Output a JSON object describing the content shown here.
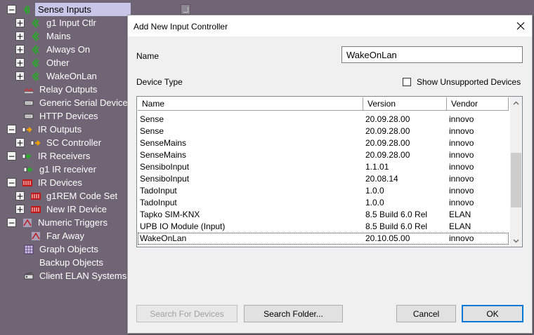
{
  "tree": {
    "nodes": [
      {
        "label": "Sense Inputs",
        "expander": "−",
        "icon": "sense-inputs-icon",
        "selected": true
      },
      {
        "label": "g1 Input Ctlr",
        "expander": "+",
        "icon": "sense-controller-icon"
      },
      {
        "label": "Mains",
        "expander": "+",
        "icon": "sense-controller-icon"
      },
      {
        "label": "Always On",
        "expander": "+",
        "icon": "sense-controller-icon"
      },
      {
        "label": "Other",
        "expander": "+",
        "icon": "sense-controller-icon"
      },
      {
        "label": "WakeOnLan",
        "expander": "+",
        "icon": "sense-controller-icon"
      },
      {
        "label": "Relay Outputs",
        "expander": "",
        "icon": "relay-icon"
      },
      {
        "label": "Generic Serial Devices",
        "expander": "",
        "icon": "serial-port-icon"
      },
      {
        "label": "HTTP Devices",
        "expander": "",
        "icon": "http-device-icon"
      },
      {
        "label": "IR Outputs",
        "expander": "−",
        "icon": "ir-output-icon"
      },
      {
        "label": "SC Controller",
        "expander": "+",
        "icon": "ir-output-icon"
      },
      {
        "label": "IR Receivers",
        "expander": "−",
        "icon": "ir-receiver-icon"
      },
      {
        "label": "g1 IR receiver",
        "expander": "",
        "icon": "ir-receiver-icon"
      },
      {
        "label": "IR Devices",
        "expander": "−",
        "icon": "ir-device-icon"
      },
      {
        "label": "g1REM Code Set",
        "expander": "+",
        "icon": "ir-device-icon"
      },
      {
        "label": "New IR Device",
        "expander": "+",
        "icon": "ir-device-icon"
      },
      {
        "label": "Numeric Triggers",
        "expander": "−",
        "icon": "trigger-icon"
      },
      {
        "label": "Far Away",
        "expander": "",
        "icon": "trigger-icon"
      },
      {
        "label": "Graph Objects",
        "expander": "",
        "icon": "graph-icon"
      },
      {
        "label": "Backup Objects",
        "expander": "",
        "icon": ""
      },
      {
        "label": "Client ELAN Systems",
        "expander": "",
        "icon": "client-systems-icon"
      }
    ]
  },
  "dialog": {
    "title": "Add New Input Controller",
    "name_label": "Name",
    "name_value": "WakeOnLan",
    "device_type_label": "Device Type",
    "show_unsupported_label": "Show Unsupported Devices",
    "columns": [
      "Name",
      "Version",
      "Vendor"
    ],
    "rows": [
      [
        "Sense",
        "20.09.28.00",
        "innovo"
      ],
      [
        "Sense",
        "20.09.28.00",
        "innovo"
      ],
      [
        "SenseMains",
        "20.09.28.00",
        "innovo"
      ],
      [
        "SenseMains",
        "20.09.28.00",
        "innovo"
      ],
      [
        "SensiboInput",
        "1.1.01",
        "innovo"
      ],
      [
        "SensiboInput",
        "20.08.14",
        "innovo"
      ],
      [
        "TadoInput",
        "1.0.0",
        "innovo"
      ],
      [
        "TadoInput",
        "1.0.0",
        "innovo"
      ],
      [
        "Tapko SIM-KNX",
        "8.5 Build 6.0 Rel",
        "ELAN"
      ],
      [
        "UPB IO Module (Input)",
        "8.5 Build 6.0 Rel",
        "ELAN"
      ],
      [
        "WakeOnLan",
        "20.10.05.00",
        "innovo"
      ]
    ],
    "selected_row": 10,
    "scroll_fraction": 0.62,
    "buttons": {
      "search_devices": "Search For Devices",
      "search_folder": "Search Folder...",
      "cancel": "Cancel",
      "ok": "OK"
    }
  },
  "colors": {
    "background": "#6f6574",
    "tree_selection": "#c8c6e8",
    "sense_icon": "#2fa52f",
    "ir_output_icon": "#f0a000",
    "ir_receiver_icon": "#22b022",
    "ir_device_icon": "#c01818",
    "default_button_border": "#0078d7"
  }
}
